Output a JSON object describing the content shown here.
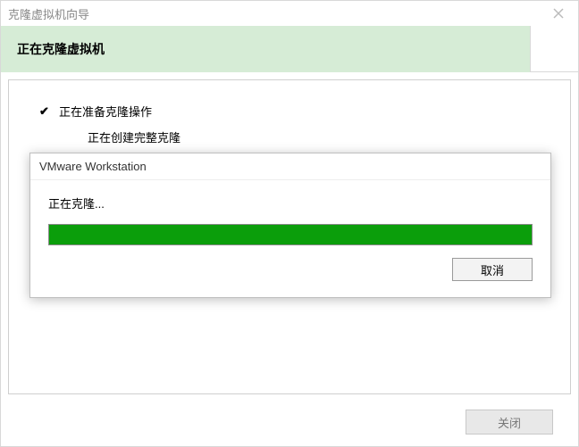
{
  "wizard": {
    "title": "克隆虚拟机向导",
    "header_title": "正在克隆虚拟机",
    "step1": "正在准备克隆操作",
    "step2": "正在创建完整克隆",
    "close_button": "关闭"
  },
  "progress_dialog": {
    "title": "VMware Workstation",
    "label": "正在克隆...",
    "percent": 100,
    "cancel": "取消"
  },
  "colors": {
    "header_bg": "#d6ecd6",
    "progress_fill": "#0b9e0b"
  }
}
